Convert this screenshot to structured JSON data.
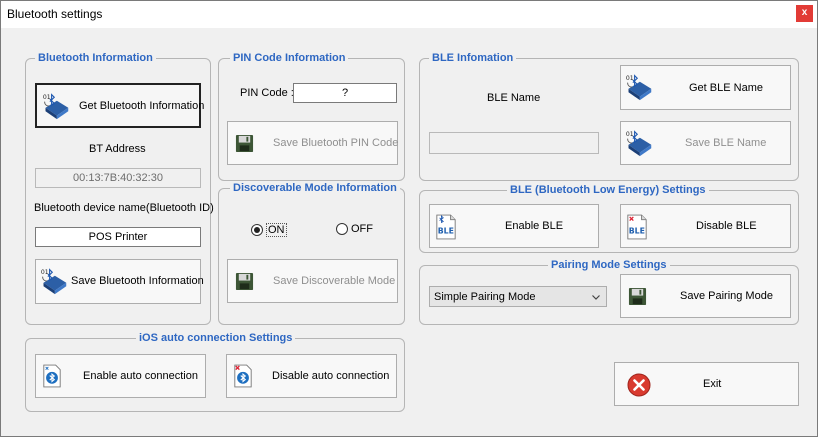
{
  "window": {
    "title": "Bluetooth settings",
    "close_label": "x"
  },
  "bt_info": {
    "title": "Bluetooth Information",
    "get_button": "Get Bluetooth Information",
    "bt_address_label": "BT Address",
    "bt_address_value": "00:13:7B:40:32:30",
    "device_name_label": "Bluetooth device name(Bluetooth ID)",
    "device_name_value": "POS Printer",
    "save_button": "Save Bluetooth Information"
  },
  "pin": {
    "title": "PIN Code Information",
    "label": "PIN Code :",
    "value": "?",
    "save_button": "Save Bluetooth PIN Code"
  },
  "discoverable": {
    "title": "Discoverable Mode Information",
    "on_label": "ON",
    "off_label": "OFF",
    "selected": "ON",
    "save_button": "Save Discoverable Mode"
  },
  "ble_info": {
    "title": "BLE Infomation",
    "name_label": "BLE Name",
    "name_value": "",
    "get_button": "Get BLE Name",
    "save_button": "Save BLE Name"
  },
  "ble_settings": {
    "title": "BLE (Bluetooth Low Energy) Settings",
    "enable_button": "Enable BLE",
    "disable_button": "Disable BLE"
  },
  "pairing": {
    "title": "Pairing Mode Settings",
    "selected_mode": "Simple Pairing Mode",
    "save_button": "Save Pairing Mode"
  },
  "ios": {
    "title": "iOS auto connection Settings",
    "enable_button": "Enable auto connection",
    "disable_button": "Disable auto connection"
  },
  "exit": {
    "label": "Exit"
  },
  "icons": {
    "bt_badge": "bluetooth-transfer-icon",
    "save": "floppy-disk-icon",
    "ble": "ble-document-icon",
    "ios": "bluetooth-document-icon",
    "exit": "exit-icon"
  },
  "colors": {
    "group_title": "#2e67c2",
    "close_button": "#e23b36",
    "exit_icon": "#d93a2f",
    "floppy": "#3d5636"
  }
}
